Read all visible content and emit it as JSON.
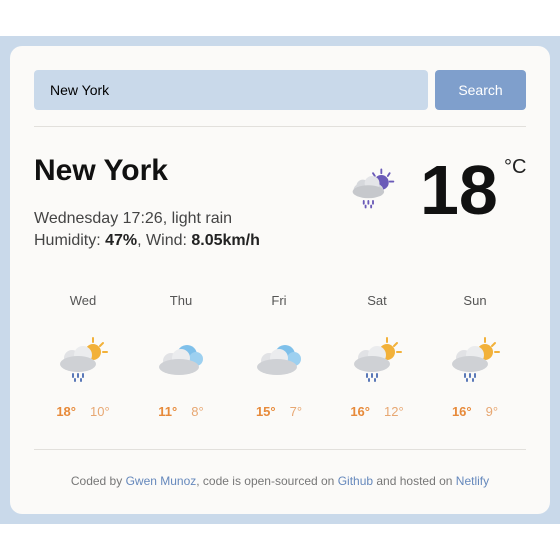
{
  "search": {
    "value": "New York",
    "button_label": "Search"
  },
  "current": {
    "city": "New York",
    "datetime_desc": "Wednesday 17:26, light rain",
    "humidity_label": "Humidity: ",
    "humidity_value": "47%",
    "wind_label": ", Wind: ",
    "wind_value": "8.05km/h",
    "temperature": "18",
    "unit": "°C",
    "icon": "sun-cloud-rain-icon"
  },
  "forecast": [
    {
      "day": "Wed",
      "max": "18°",
      "min": "10°",
      "icon": "sun-cloud-rain-icon"
    },
    {
      "day": "Thu",
      "max": "11°",
      "min": "8°",
      "icon": "cloud-icon"
    },
    {
      "day": "Fri",
      "max": "15°",
      "min": "7°",
      "icon": "cloud-icon"
    },
    {
      "day": "Sat",
      "max": "16°",
      "min": "12°",
      "icon": "sun-cloud-rain-icon"
    },
    {
      "day": "Sun",
      "max": "16°",
      "min": "9°",
      "icon": "sun-cloud-rain-icon"
    }
  ],
  "footer": {
    "prefix": "Coded by ",
    "author": "Gwen Munoz",
    "middle": ", code is open-sourced on ",
    "repo": "Github",
    "suffix": " and hosted on ",
    "host": "Netlify"
  },
  "colors": {
    "accent": "#7f9fcc",
    "input_bg": "#c9d9ea",
    "temp_max": "#e78a3a",
    "temp_min": "#e7a772",
    "link": "#6588bc"
  }
}
